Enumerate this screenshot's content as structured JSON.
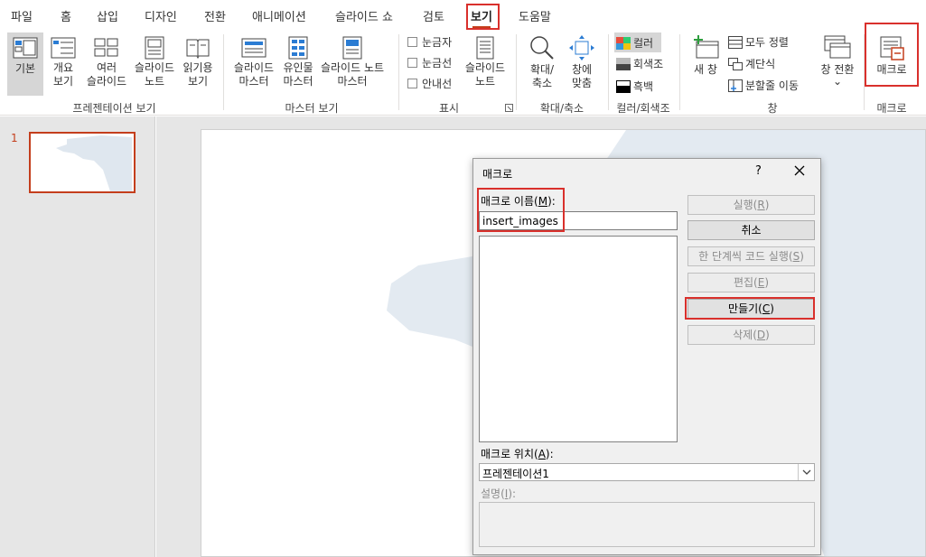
{
  "menu": {
    "tabs": [
      "파일",
      "홈",
      "삽입",
      "디자인",
      "전환",
      "애니메이션",
      "슬라이드 쇼",
      "검토",
      "보기",
      "도움말"
    ],
    "active_tab": "보기"
  },
  "ribbon": {
    "presentation_views": {
      "label": "프레젠테이션 보기",
      "normal": "기본",
      "outline_1": "개요",
      "outline_2": "보기",
      "sorter_1": "여러",
      "sorter_2": "슬라이드",
      "notes_1": "슬라이드",
      "notes_2": "노트",
      "reading_1": "읽기용",
      "reading_2": "보기"
    },
    "master_views": {
      "label": "마스터 보기",
      "slide_master_1": "슬라이드",
      "slide_master_2": "마스터",
      "handout_master_1": "유인물",
      "handout_master_2": "마스터",
      "notes_master_1": "슬라이드 노트",
      "notes_master_2": "마스터"
    },
    "show": {
      "label": "표시",
      "ruler": "눈금자",
      "gridlines": "눈금선",
      "guides": "안내선",
      "notes_1": "슬라이드",
      "notes_2": "노트"
    },
    "zoom": {
      "label": "확대/축소",
      "zoom_1": "확대/",
      "zoom_2": "축소",
      "fit_1": "창에",
      "fit_2": "맞춤"
    },
    "color": {
      "label": "컬러/회색조",
      "color": "컬러",
      "grayscale": "회색조",
      "bw": "흑백"
    },
    "window": {
      "label": "창",
      "new_window": "새 창",
      "arrange_all": "모두 정렬",
      "cascade": "계단식",
      "move_split": "분할줄 이동",
      "switch_1": "창 전환",
      "switch_2": "⌄"
    },
    "macros": {
      "label": "매크로",
      "button": "매크로"
    }
  },
  "thumbnails": {
    "slide_number": "1"
  },
  "dialog": {
    "title": "매크로",
    "help": "?",
    "name_label": "매크로 이름(M):",
    "name_label_pre": "매크로 이름(",
    "name_label_key": "M",
    "name_label_post": "):",
    "name_value": "insert_images",
    "buttons": {
      "run_pre": "실행(",
      "run_key": "R",
      "run_post": ")",
      "cancel": "취소",
      "step_pre": "한 단계씩 코드 실행(",
      "step_key": "S",
      "step_post": ")",
      "edit_pre": "편집(",
      "edit_key": "E",
      "edit_post": ")",
      "create_pre": "만들기(",
      "create_key": "C",
      "create_post": ")",
      "delete_pre": "삭제(",
      "delete_key": "D",
      "delete_post": ")"
    },
    "location_label_pre": "매크로 위치(",
    "location_label_key": "A",
    "location_label_post": "):",
    "location_value": "프레젠테이션1",
    "description_label_pre": "설명(",
    "description_label_key": "I",
    "description_label_post": "):"
  },
  "colors": {
    "accent": "#c43e1c",
    "highlight_box": "#d9302c",
    "workspace": "#e6e6e6"
  }
}
